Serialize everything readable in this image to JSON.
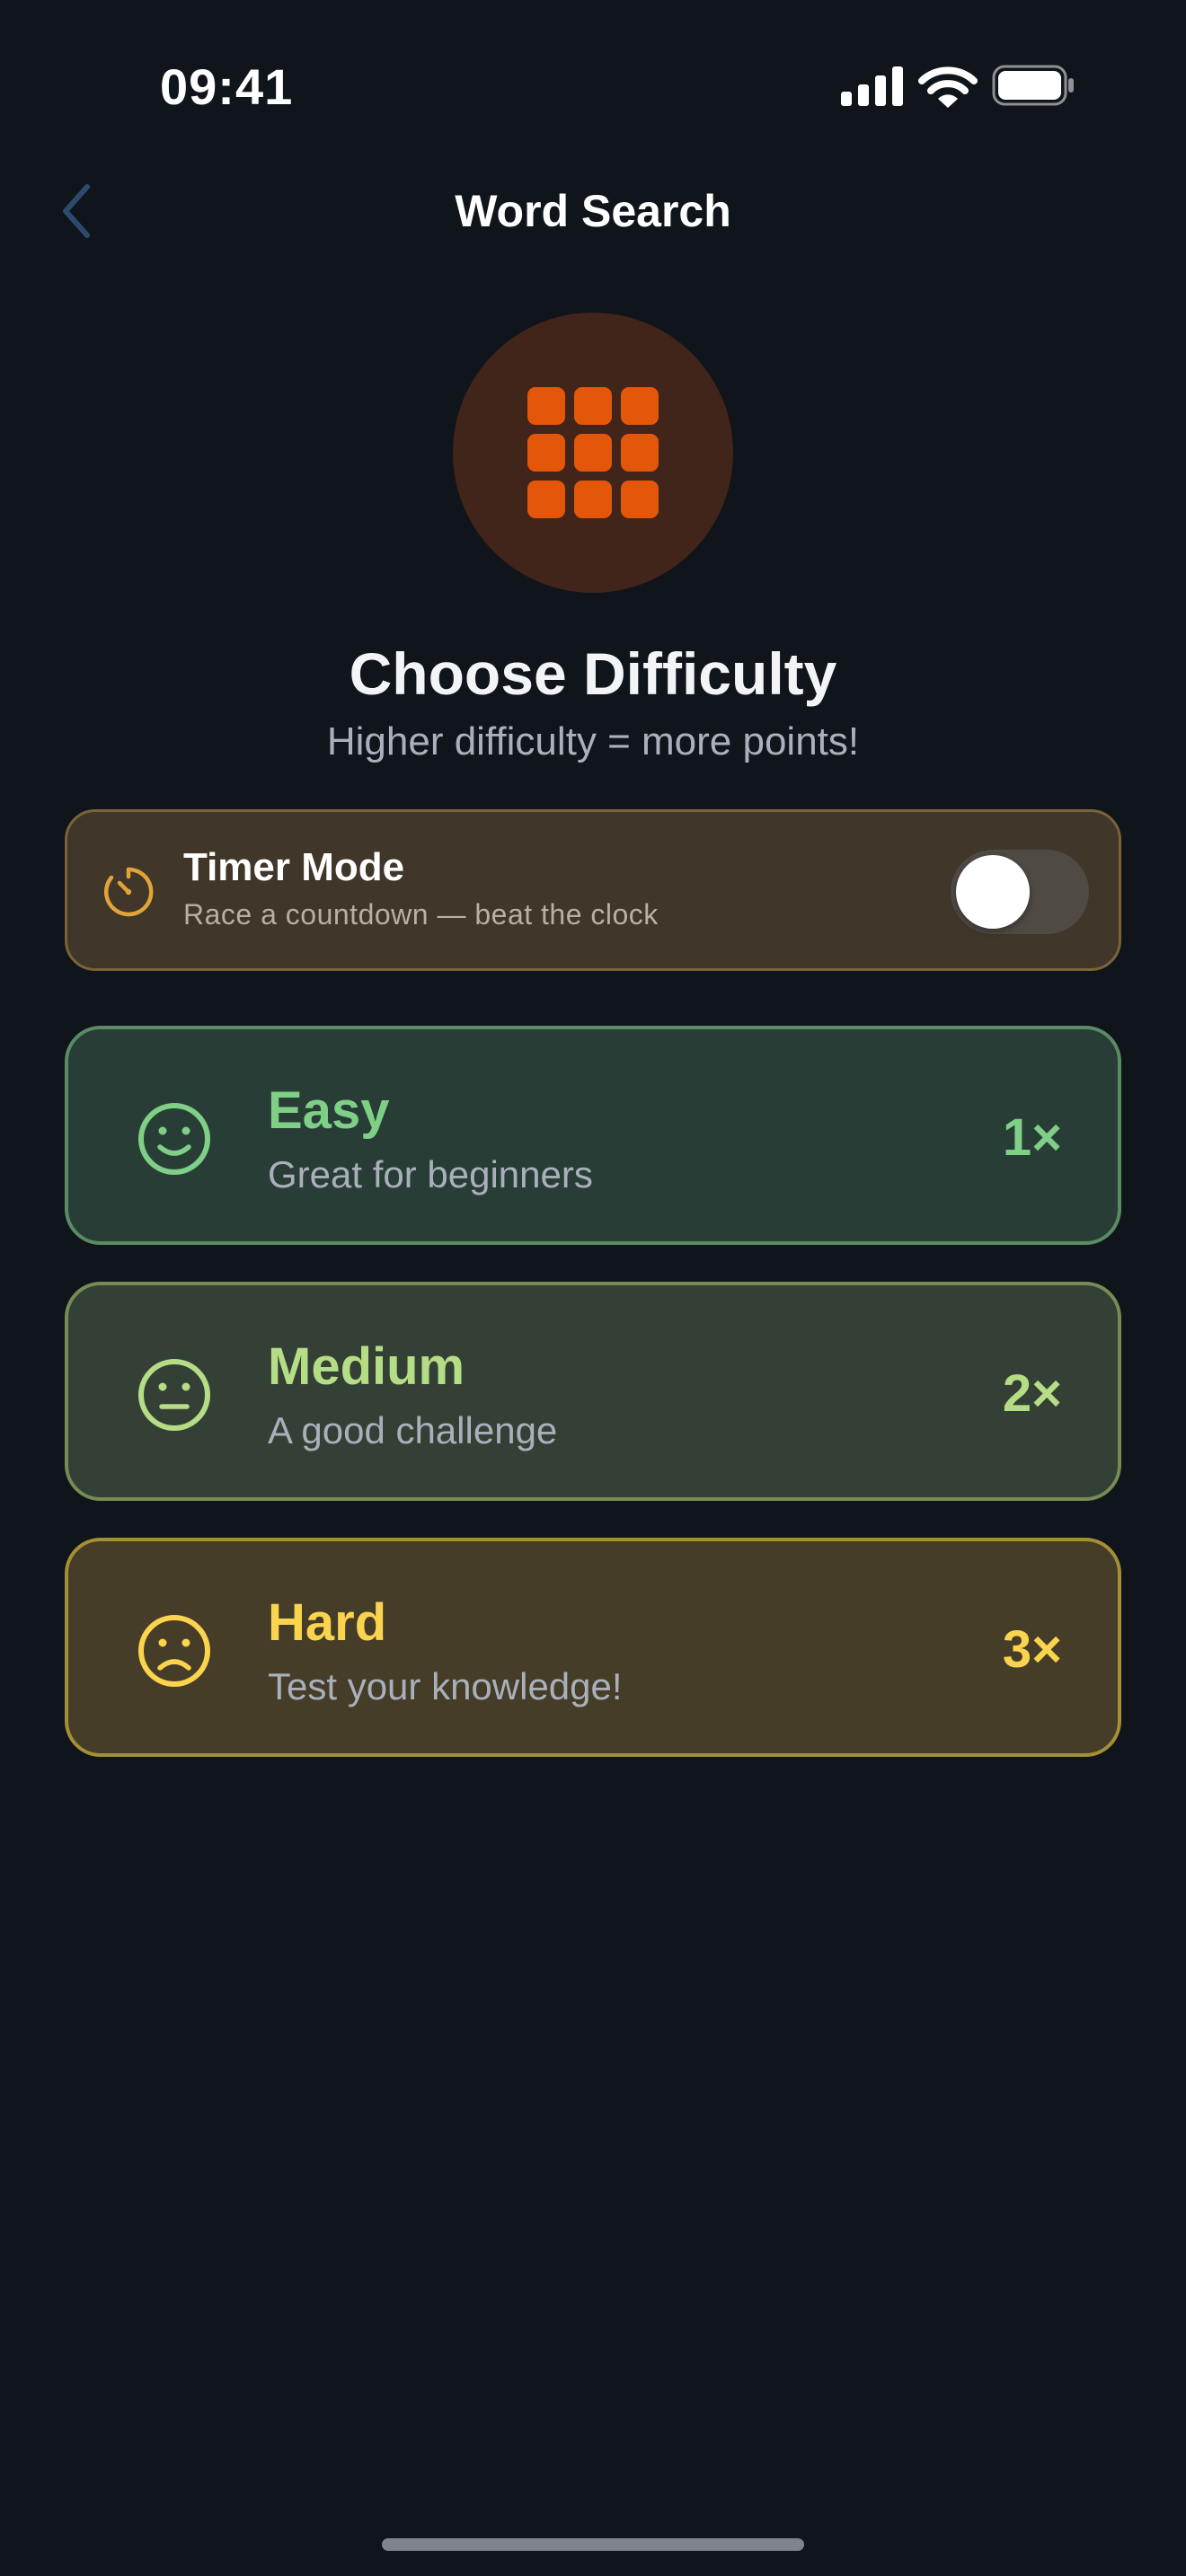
{
  "status_bar": {
    "time": "09:41"
  },
  "nav": {
    "title": "Word Search",
    "back_icon": "chevron-left-icon"
  },
  "hero": {
    "icon": "grid-icon",
    "heading": "Choose Difficulty",
    "subheading": "Higher difficulty = more points!"
  },
  "timer_mode": {
    "title": "Timer Mode",
    "subtitle": "Race a countdown — beat the clock",
    "icon": "stopwatch-icon",
    "enabled": false
  },
  "difficulties": [
    {
      "name": "Easy",
      "description": "Great for beginners",
      "multiplier": "1×",
      "icon": "happy-face-icon",
      "color": "#7fcf86"
    },
    {
      "name": "Medium",
      "description": "A good challenge",
      "multiplier": "2×",
      "icon": "neutral-face-icon",
      "color": "#b5dd86"
    },
    {
      "name": "Hard",
      "description": "Test your knowledge!",
      "multiplier": "3×",
      "icon": "sad-face-icon",
      "color": "#fbd44e"
    }
  ],
  "colors": {
    "background": "#10141b",
    "accent_orange": "#e4560a",
    "back_chevron": "#2c4a6b",
    "timer_icon": "#e0a437"
  }
}
